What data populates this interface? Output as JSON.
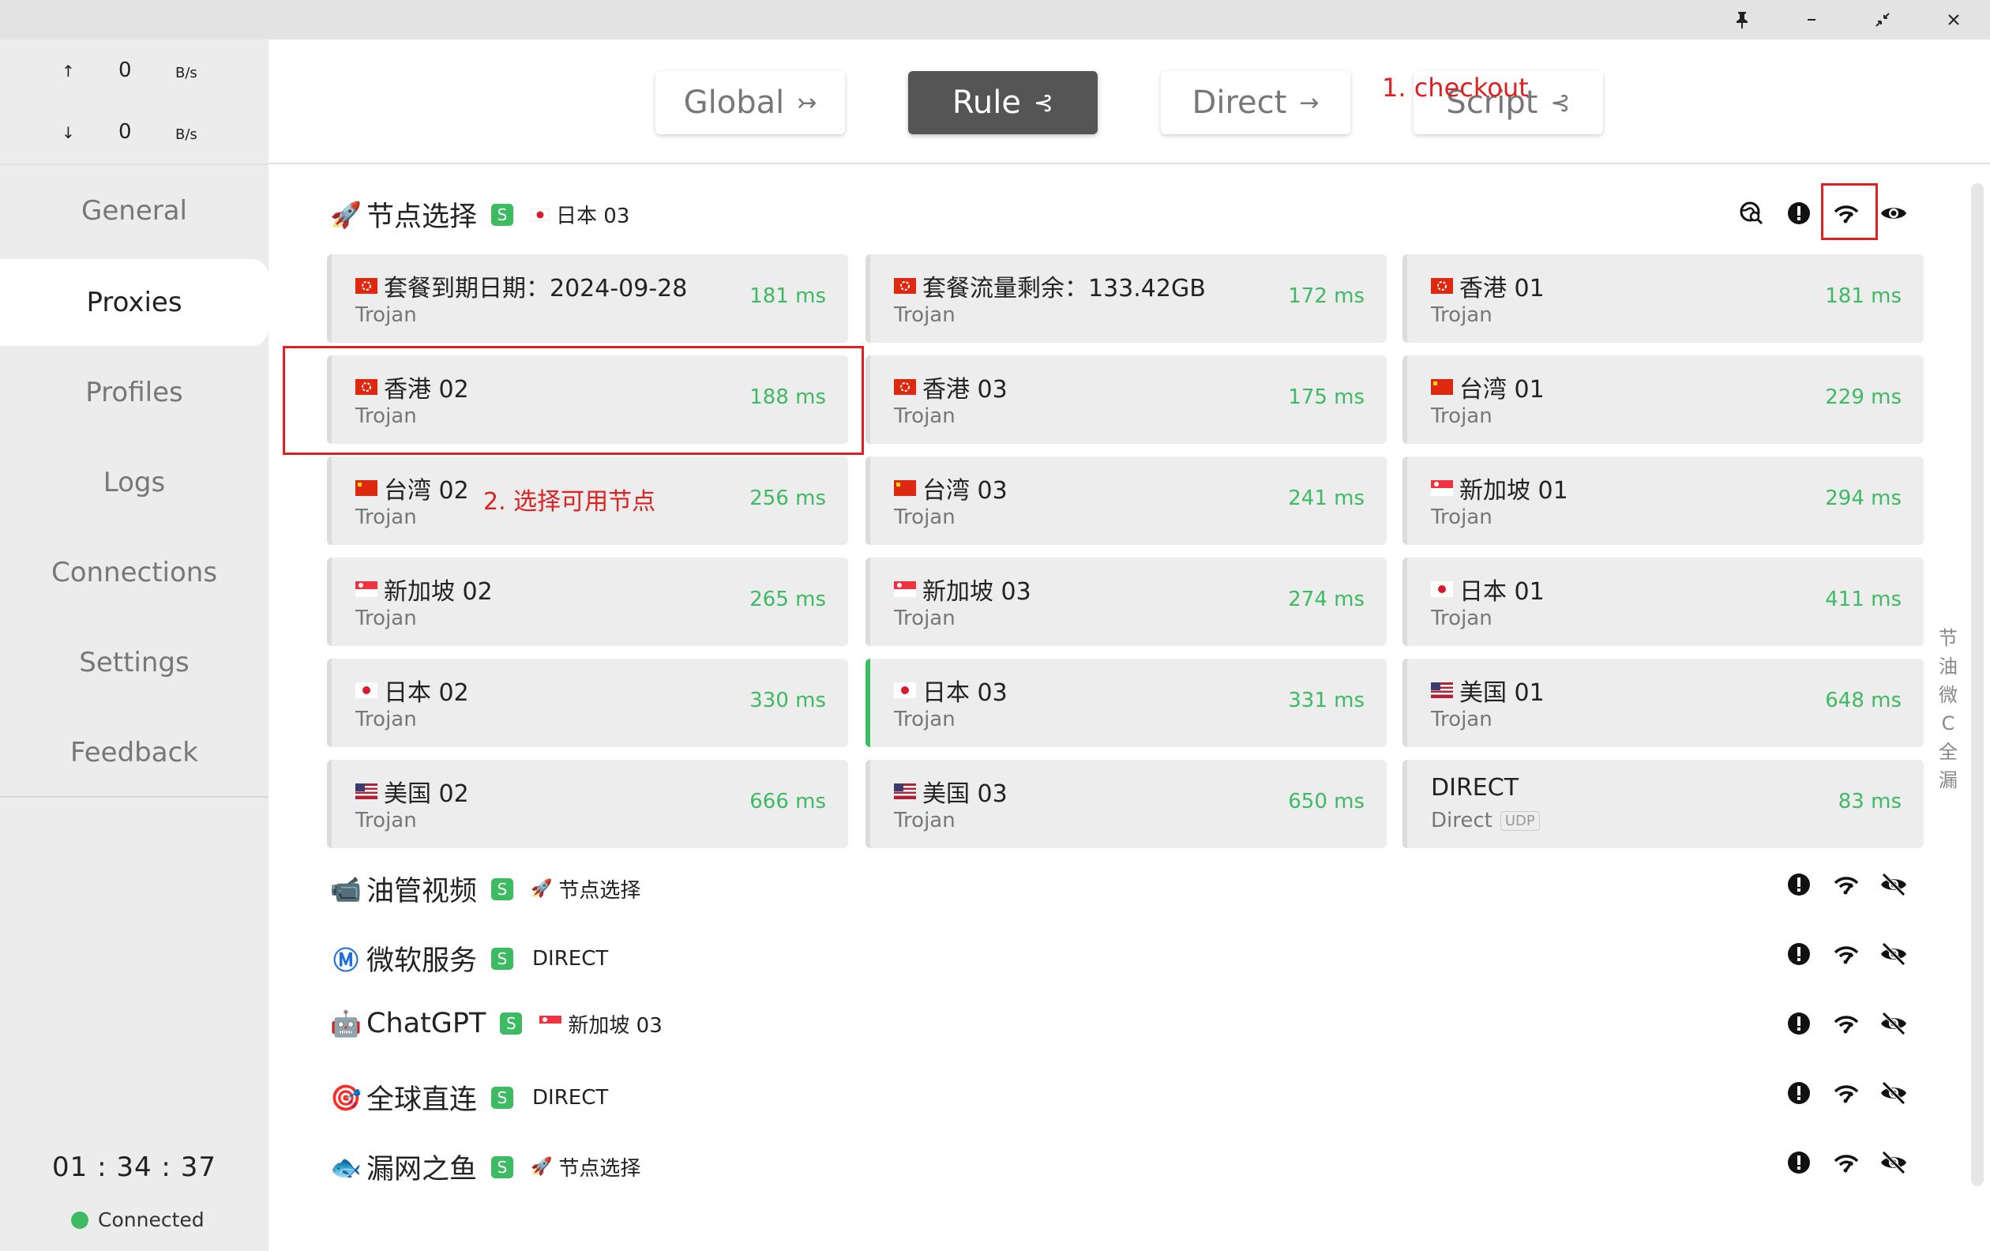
{
  "window": {
    "pin_icon": "pin-icon",
    "minimize_icon": "minimize-icon",
    "restore_icon": "restore-icon",
    "close_icon": "close-icon"
  },
  "traffic": {
    "up_arrow": "↑",
    "up_value": "0",
    "up_unit": "B/s",
    "down_arrow": "↓",
    "down_value": "0",
    "down_unit": "B/s"
  },
  "sidebar": {
    "items": [
      {
        "label": "General"
      },
      {
        "label": "Proxies"
      },
      {
        "label": "Profiles"
      },
      {
        "label": "Logs"
      },
      {
        "label": "Connections"
      },
      {
        "label": "Settings"
      },
      {
        "label": "Feedback"
      }
    ],
    "active": "Proxies",
    "clock": "01 : 34 : 37",
    "status": "Connected"
  },
  "modes": [
    {
      "label": "Global",
      "icon": "↣"
    },
    {
      "label": "Rule",
      "icon": "⊰"
    },
    {
      "label": "Direct",
      "icon": "→"
    },
    {
      "label": "Script",
      "icon": "⊰"
    }
  ],
  "active_mode": "Rule",
  "annotations": {
    "step1": "1. checkout",
    "step2": "2. 选择可用节点"
  },
  "groups": [
    {
      "name": "节点选择",
      "emoji": "🚀",
      "badge": "S",
      "selected_flag": "jp",
      "selected": "日本 03",
      "expanded": true
    },
    {
      "name": "油管视频",
      "emoji": "📹",
      "badge": "S",
      "selected_flag": "rocket",
      "selected": "节点选择"
    },
    {
      "name": "微软服务",
      "emoji": "Ⓜ",
      "badge": "S",
      "selected_flag": "",
      "selected": "DIRECT"
    },
    {
      "name": "ChatGPT",
      "emoji": "🤖",
      "badge": "S",
      "selected_flag": "sg",
      "selected": "新加坡 03"
    },
    {
      "name": "全球直连",
      "emoji": "🎯",
      "badge": "S",
      "selected_flag": "",
      "selected": "DIRECT"
    },
    {
      "name": "漏网之鱼",
      "emoji": "🐟",
      "badge": "S",
      "selected_flag": "rocket",
      "selected": "节点选择"
    }
  ],
  "proxies": [
    {
      "flag": "hk",
      "name": "套餐到期日期：2024-09-28",
      "type": "Trojan",
      "delay": "181 ms"
    },
    {
      "flag": "hk",
      "name": "套餐流量剩余：133.42GB",
      "type": "Trojan",
      "delay": "172 ms"
    },
    {
      "flag": "hk",
      "name": "香港 01",
      "type": "Trojan",
      "delay": "181 ms"
    },
    {
      "flag": "hk",
      "name": "香港 02",
      "type": "Trojan",
      "delay": "188 ms"
    },
    {
      "flag": "hk",
      "name": "香港 03",
      "type": "Trojan",
      "delay": "175 ms"
    },
    {
      "flag": "cn",
      "name": "台湾 01",
      "type": "Trojan",
      "delay": "229 ms"
    },
    {
      "flag": "cn",
      "name": "台湾 02",
      "type": "Trojan",
      "delay": "256 ms"
    },
    {
      "flag": "cn",
      "name": "台湾 03",
      "type": "Trojan",
      "delay": "241 ms"
    },
    {
      "flag": "sg",
      "name": "新加坡 01",
      "type": "Trojan",
      "delay": "294 ms"
    },
    {
      "flag": "sg",
      "name": "新加坡 02",
      "type": "Trojan",
      "delay": "265 ms"
    },
    {
      "flag": "sg",
      "name": "新加坡 03",
      "type": "Trojan",
      "delay": "274 ms"
    },
    {
      "flag": "jp",
      "name": "日本 01",
      "type": "Trojan",
      "delay": "411 ms"
    },
    {
      "flag": "jp",
      "name": "日本 02",
      "type": "Trojan",
      "delay": "330 ms"
    },
    {
      "flag": "jp",
      "name": "日本 03",
      "type": "Trojan",
      "delay": "331 ms",
      "selected": true
    },
    {
      "flag": "us",
      "name": "美国 01",
      "type": "Trojan",
      "delay": "648 ms"
    },
    {
      "flag": "us",
      "name": "美国 02",
      "type": "Trojan",
      "delay": "666 ms"
    },
    {
      "flag": "us",
      "name": "美国 03",
      "type": "Trojan",
      "delay": "650 ms"
    },
    {
      "flag": "",
      "name": "DIRECT",
      "type": "Direct",
      "udp": "UDP",
      "delay": "83 ms"
    }
  ],
  "side_vertical_text": "节油微C全漏",
  "colors": {
    "accent": "#3dbb62",
    "annotation": "#e02020",
    "active_mode": "#555555"
  }
}
